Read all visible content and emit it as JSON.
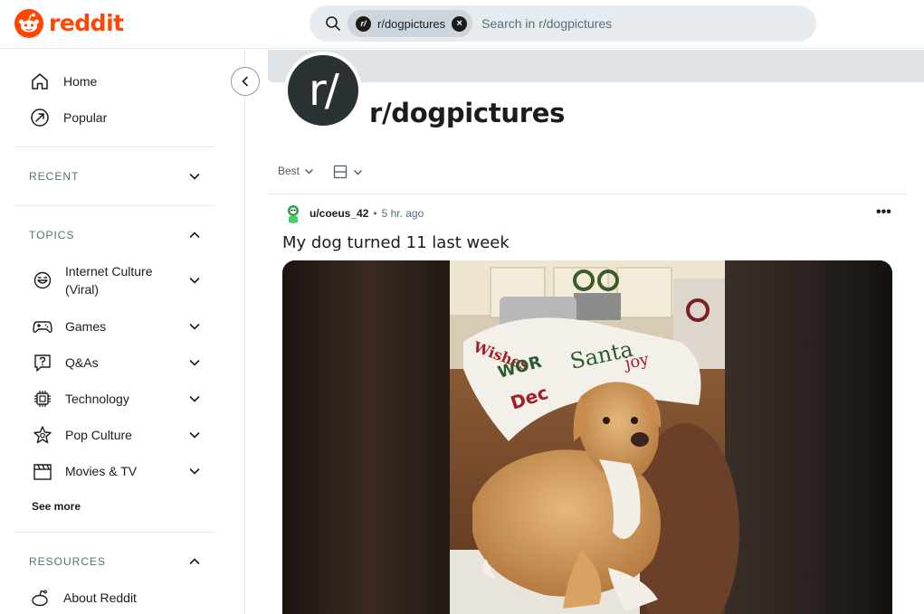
{
  "header": {
    "logo_text": "reddit",
    "brand_color": "#ff4500",
    "search": {
      "chip_label": "r/dogpictures",
      "placeholder": "Search in r/dogpictures"
    }
  },
  "sidebar": {
    "main_items": [
      {
        "label": "Home",
        "icon": "home-icon"
      },
      {
        "label": "Popular",
        "icon": "popular-icon"
      }
    ],
    "recent": {
      "label": "RECENT",
      "expanded": false
    },
    "topics": {
      "label": "TOPICS",
      "expanded": true,
      "items": [
        {
          "label": "Internet Culture (Viral)",
          "icon": "smile-icon"
        },
        {
          "label": "Games",
          "icon": "gamepad-icon"
        },
        {
          "label": "Q&As",
          "icon": "question-icon"
        },
        {
          "label": "Technology",
          "icon": "chip-icon"
        },
        {
          "label": "Pop Culture",
          "icon": "star-icon"
        },
        {
          "label": "Movies & TV",
          "icon": "clapper-icon"
        }
      ],
      "see_more": "See more"
    },
    "resources": {
      "label": "RESOURCES",
      "expanded": true,
      "items": [
        {
          "label": "About Reddit",
          "icon": "about-icon"
        }
      ]
    }
  },
  "subreddit": {
    "avatar_text": "r/",
    "name": "r/dogpictures"
  },
  "feed": {
    "sort_label": "Best",
    "view_icon": "card-view-icon"
  },
  "post": {
    "user": "u/coeus_42",
    "separator": "•",
    "time": "5 hr. ago",
    "overflow": "•••",
    "title": "My dog turned 11 last week"
  }
}
